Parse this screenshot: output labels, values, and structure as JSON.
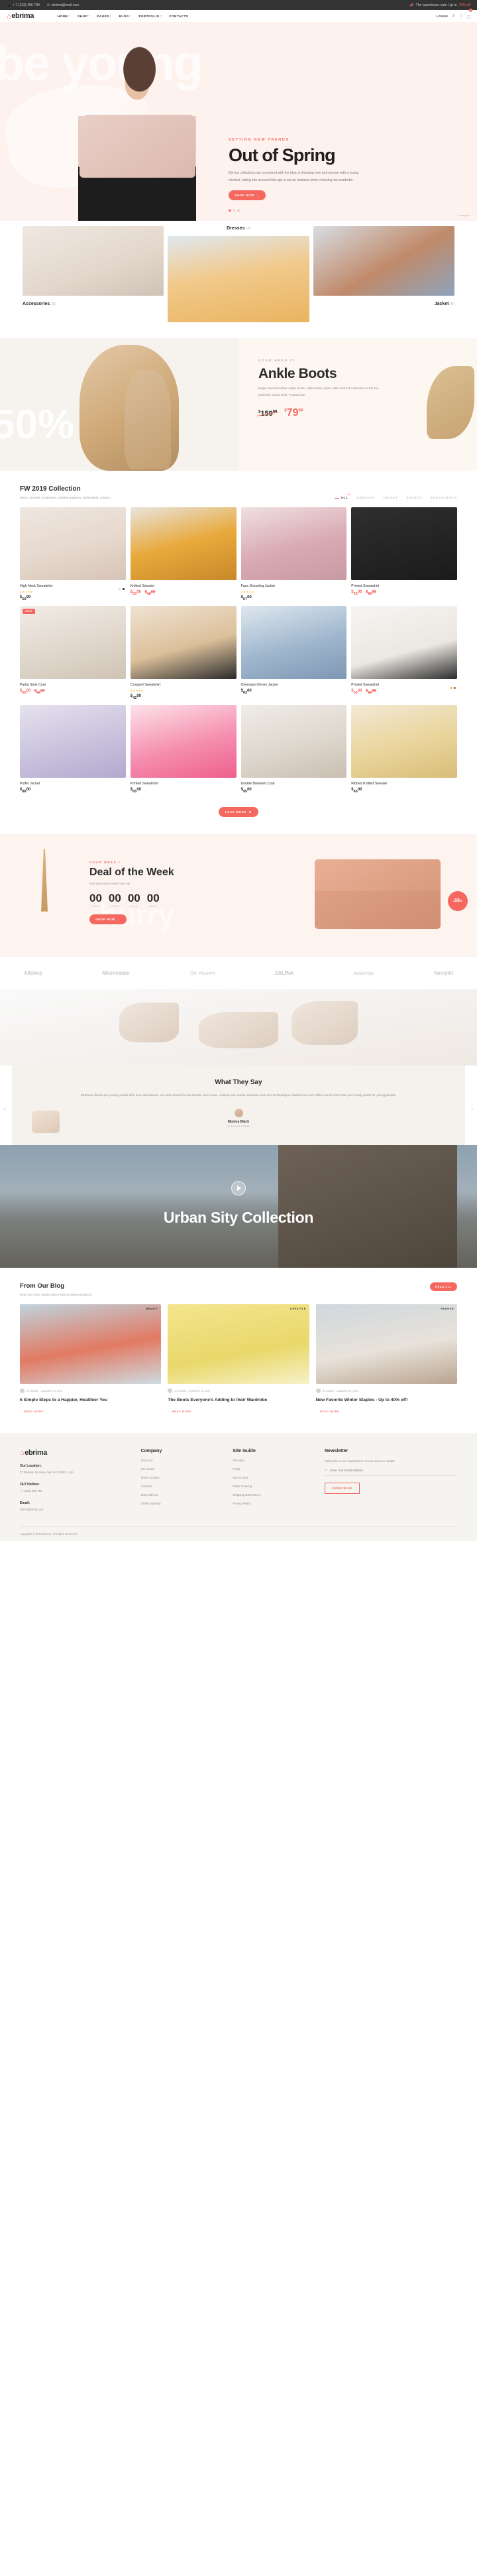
{
  "topbar": {
    "phone": "+ 7 (123) 456 789",
    "email": "ebrima@mail.com",
    "promo_text": "The warehouse sale. Up to",
    "promo_highlight": "70% off",
    "phone_icon": "phone-icon",
    "mail_icon": "mail-icon",
    "megaphone_icon": "megaphone-icon"
  },
  "header": {
    "brand": "ebrima",
    "nav": [
      "HOME",
      "SHOP",
      "PAGES",
      "BLOG",
      "PORTFOLIO",
      "CONTACTS"
    ],
    "login_label": "LOGIN",
    "search_icon": "search-icon",
    "heart_icon": "heart-icon",
    "cart_icon": "cart-icon",
    "cart_count": "0"
  },
  "hero": {
    "ghost_word": "be young",
    "eyebrow": "SETTING NEW TRENDS",
    "title": "Out of Spring",
    "paragraph": "Ebrima collections are conceived with the idea of dressing men and women with a young mindset, taking into account that age is not an obstacle when choosing our wardrobe.",
    "cta": "SHOP NOW",
    "signature": "Instagram"
  },
  "categories": [
    {
      "label": "Accessories",
      "count": "(1)"
    },
    {
      "label": "Dresses",
      "count": "(3)"
    },
    {
      "label": "Jacket",
      "count": "(6)"
    }
  ],
  "promo": {
    "percent": "50%",
    "eyebrow": "YOUR NEED IT",
    "title": "Ankle Boots",
    "paragraph": "Beige heeled leather ankle boots. Split suede upper with contrast materials on the toe and heel. Lined heel. Pointed toe.",
    "price_old": "159",
    "price_old_cents": "99",
    "price_new": "79",
    "price_new_cents": "99",
    "currency": "$"
  },
  "collection": {
    "title": "FW 2019 Collection",
    "subtitle": "Music, screens, projections, modern graphics, fashionable, colours...",
    "filters": [
      {
        "label": "ALL",
        "badge": "12",
        "active": true
      },
      {
        "label": "DRESSES",
        "badge": "",
        "active": false
      },
      {
        "label": "JACKET",
        "badge": "",
        "active": false
      },
      {
        "label": "SHORTS",
        "badge": "",
        "active": false
      },
      {
        "label": "SWEATSHIRTS",
        "badge": "",
        "active": false
      }
    ],
    "load_more": "LOAD MORE",
    "products": [
      {
        "name": "High Neck Sweatshirt",
        "price": "59",
        "cents": "99",
        "old": "",
        "old_cents": "",
        "stars": "★★★★★",
        "tag": "",
        "img": "linear-gradient(165deg,#efe7e0,#e6d8cd 55%,#d6c4b6)",
        "swatches": [
          "#ddd8d3",
          "#2b2b2b"
        ]
      },
      {
        "name": "Knitted Sweater",
        "price": "20",
        "cents": "00",
        "old": "18",
        "old_cents": "00",
        "stars": "",
        "tag": "",
        "img": "linear-gradient(165deg,#e9e4de,#e8a93c 50%,#c9882a)",
        "swatches": []
      },
      {
        "name": "Faux Shearling Jacket",
        "price": "67",
        "cents": "00",
        "old": "",
        "old_cents": "",
        "stars": "★★★★★",
        "tag": "",
        "img": "linear-gradient(165deg,#efe0e2,#d9a9b3 55%,#c89aa4)",
        "swatches": []
      },
      {
        "name": "Printed Sweatshirt",
        "price": "65",
        "cents": "00",
        "old": "55",
        "old_cents": "00",
        "stars": "",
        "tag": "",
        "img": "linear-gradient(165deg,#2f2f2f,#1b1b1b)",
        "swatches": []
      },
      {
        "name": "Parka Style Coat",
        "price": "68",
        "cents": "00",
        "old": "54",
        "old_cents": "00",
        "stars": "",
        "tag": "SALE",
        "img": "linear-gradient(165deg,#f1ece6,#e0d7cc 55%,#cfc3b5)",
        "swatches": []
      },
      {
        "name": "Cropped Sweatshirt",
        "price": "42",
        "cents": "00",
        "old": "",
        "old_cents": "",
        "stars": "★★★★★",
        "tag": "",
        "img": "linear-gradient(165deg,#efe2d2,#dcc09b 55%,#2b2b2b)",
        "swatches": []
      },
      {
        "name": "Oversized Denim Jacket",
        "price": "62",
        "cents": "00",
        "old": "",
        "old_cents": "",
        "stars": "",
        "tag": "",
        "img": "linear-gradient(165deg,#dfe7ef,#9fb6cd 55%,#7e97b2)",
        "swatches": []
      },
      {
        "name": "Printed Sweatshirt",
        "price": "65",
        "cents": "00",
        "old": "55",
        "old_cents": "00",
        "stars": "",
        "tag": "",
        "img": "linear-gradient(165deg,#f7f5f2,#ebe7e2 60%,#2b2b2b)",
        "swatches": [
          "#e6b45c",
          "#c94f3d"
        ]
      },
      {
        "name": "Puffer Jacket",
        "price": "88",
        "cents": "00",
        "old": "",
        "old_cents": "",
        "stars": "",
        "tag": "",
        "img": "linear-gradient(165deg,#e6e2ee,#c9c2dd 55%,#b3a9cf)",
        "swatches": []
      },
      {
        "name": "Printed Sweatshirt",
        "price": "65",
        "cents": "00",
        "old": "",
        "old_cents": "",
        "stars": "",
        "tag": "",
        "img": "linear-gradient(165deg,#fde3ea,#f58fb0 55%,#ee5f8d)",
        "swatches": []
      },
      {
        "name": "Double Breasted Coat",
        "price": "95",
        "cents": "00",
        "old": "",
        "old_cents": "",
        "stars": "",
        "tag": "",
        "img": "linear-gradient(165deg,#efece7,#ded7cd 55%,#c9bfb2)",
        "swatches": []
      },
      {
        "name": "Ribbed Knitted Sweater",
        "price": "45",
        "cents": "00",
        "old": "",
        "old_cents": "",
        "stars": "",
        "tag": "",
        "img": "linear-gradient(165deg,#f3e9d6,#e9d49a 55%,#d8bd79)",
        "swatches": []
      }
    ]
  },
  "deal": {
    "ghost": "hurry",
    "eyebrow": "YOUR WEEK !",
    "title": "Deal of the Week",
    "subtitle": "New deal every week! hurry up!",
    "timer": [
      {
        "num": "00",
        "label": "DAYS"
      },
      {
        "num": "00",
        "label": "HOURS"
      },
      {
        "num": "00",
        "label": "MINS"
      },
      {
        "num": "00",
        "label": "SECS"
      }
    ],
    "cta": "SHOP NOW",
    "badge_price": "59",
    "badge_cents": "99",
    "badge_currency": "$"
  },
  "brands": [
    "Allshop",
    "Microvaaze",
    "The Weavers",
    "ZALINA",
    "modernize",
    "fancykit"
  ],
  "testimonial": {
    "heading": "What They Say",
    "quote": "Ebrima's clients are young people who love adventures, are well versed in new trends, love music, actively use social networks and new technologies, fashion for men offers much more than just trendy pants for young people.",
    "name": "Monica Black",
    "role": "CLIENT OF STORE",
    "prev_icon": "arrow-left-icon",
    "next_icon": "arrow-right-icon"
  },
  "video": {
    "title": "Urban Sity Collection",
    "play_icon": "play-icon"
  },
  "blog": {
    "title": "From Our Blog",
    "subtitle": "Read our recent articles about fashion ideas & products",
    "cta": "READ ALL",
    "posts": [
      {
        "category": "BEAUTY",
        "author": "BY ADMIN",
        "date": "JANUARY 14, 2020",
        "title": "5 Simple Steps to a Happier, Healthier You",
        "read": "READ MORE"
      },
      {
        "category": "LIFESTYLE",
        "author": "BY ADMIN",
        "date": "JANUARY 14, 2020",
        "title": "The Boots Everyone's Adding to their Wardrobe",
        "read": "READ MORE"
      },
      {
        "category": "FASHION",
        "author": "BY ADMIN",
        "date": "JANUARY 14, 2020",
        "title": "New Favorite Winter Staples - Up to 40% off!",
        "read": "READ MORE"
      }
    ]
  },
  "footer": {
    "brand": "ebrima",
    "location_label": "Our Location:",
    "location_value": "27 Division St, New York, NY 10002, USA",
    "hotline_label": "24/7 Hotline:",
    "hotline_value": "+7 (123) 456 789",
    "email_label": "Email:",
    "email_value": "ebrima@mail.com",
    "company_heading": "Company",
    "company_links": [
      "About Us",
      "Our Studio",
      "Store Location",
      "Contacts",
      "Work with Us",
      "Orders tracking"
    ],
    "guide_heading": "Site Guide",
    "guide_links": [
      "The Blog",
      "FAQs",
      "My Account",
      "Order Tracking",
      "Shipping and Returns",
      "Privacy Policy"
    ],
    "newsletter_heading": "Newsletter",
    "newsletter_desc": "Subscribe to our newsletter to receive news on update.",
    "email_placeholder": "Enter Your Email Address",
    "subscribe_label": "SUBSCRIBE",
    "copyright": "Copyright © 2019 Ebrima. All Rights Reserved."
  }
}
